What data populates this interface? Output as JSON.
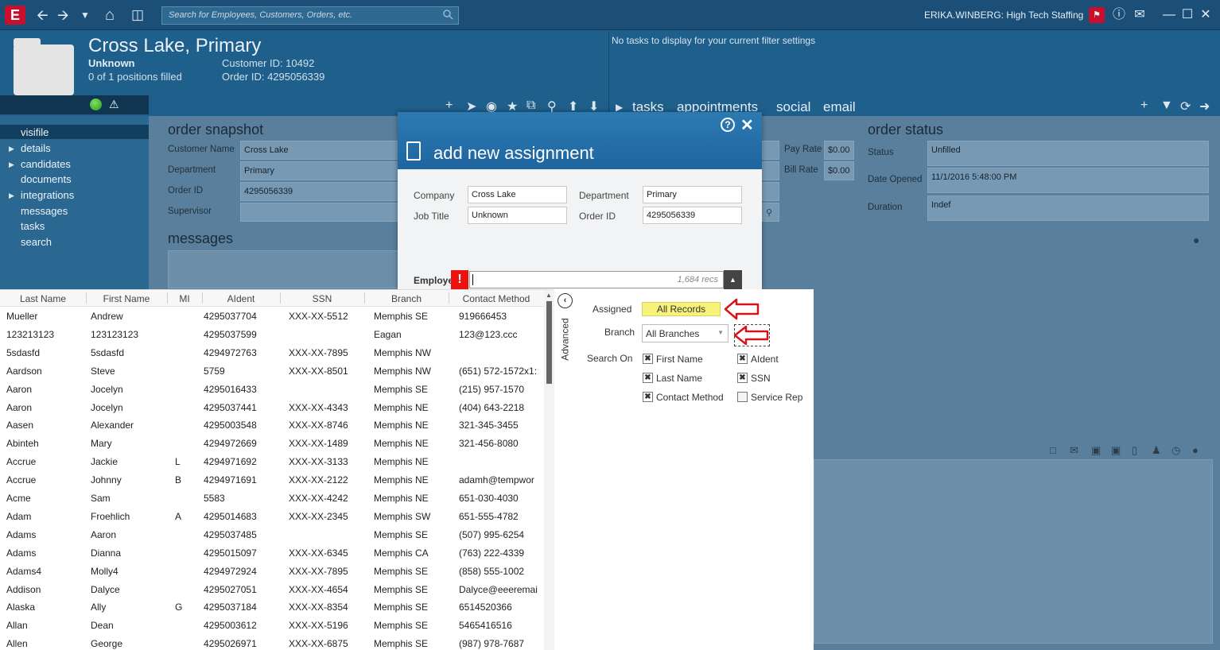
{
  "app": {
    "logo": "E",
    "search_placeholder": "Search for Employees, Customers, Orders, etc.",
    "user": "ERIKA.WINBERG: High Tech Staffing"
  },
  "order": {
    "title": "Cross Lake, Primary",
    "job_title": "Unknown",
    "positions": "0 of 1 positions filled",
    "customer_id": "Customer ID: 10492",
    "order_id": "Order ID: 4295056339"
  },
  "tasks": {
    "empty_message": "No tasks to display for your current filter settings",
    "tabs": [
      "tasks",
      "appointments",
      "social",
      "email"
    ]
  },
  "nav": {
    "items": [
      "visifile",
      "details",
      "candidates",
      "documents",
      "integrations",
      "messages",
      "tasks",
      "search"
    ]
  },
  "snapshot": {
    "title": "order snapshot",
    "customer_name_label": "Customer Name",
    "customer_name": "Cross Lake",
    "department_label": "Department",
    "department": "Primary",
    "order_id_label": "Order ID",
    "order_id": "4295056339",
    "supervisor_label": "Supervisor",
    "pay_rate_label": "Pay Rate",
    "pay_rate": "$0.00",
    "bill_rate_label": "Bill Rate",
    "bill_rate": "$0.00",
    "messages_title": "messages"
  },
  "order_status": {
    "title": "order status",
    "status_label": "Status",
    "status": "Unfilled",
    "date_opened_label": "Date Opened",
    "date_opened": "11/1/2016 5:48:00 PM",
    "duration_label": "Duration",
    "duration": "Indef"
  },
  "modal": {
    "title": "add new assignment",
    "company_label": "Company",
    "company": "Cross Lake",
    "department_label": "Department",
    "department": "Primary",
    "job_title_label": "Job Title",
    "job_title": "Unknown",
    "order_id_label": "Order ID",
    "order_id": "4295056339",
    "employee_label": "Employee",
    "records": "1,684 recs"
  },
  "grid": {
    "columns": [
      "Last Name",
      "First Name",
      "MI",
      "AIdent",
      "SSN",
      "Branch",
      "Contact Method"
    ],
    "rows": [
      [
        "Mueller",
        "Andrew",
        "",
        "4295037704",
        "XXX-XX-5512",
        "Memphis SE",
        "919666453"
      ],
      [
        "123213123",
        "123123123",
        "",
        "4295037599",
        "",
        "Eagan",
        "123@123.ccc"
      ],
      [
        "5sdasfd",
        "5sdasfd",
        "",
        "4294972763",
        "XXX-XX-7895",
        "Memphis NW",
        ""
      ],
      [
        "Aardson",
        "Steve",
        "",
        "5759",
        "XXX-XX-8501",
        "Memphis NW",
        "(651) 572-1572x1:"
      ],
      [
        "Aaron",
        "Jocelyn",
        "",
        "4295016433",
        "",
        "Memphis SE",
        "(215) 957-1570"
      ],
      [
        "Aaron",
        "Jocelyn",
        "",
        "4295037441",
        "XXX-XX-4343",
        "Memphis NE",
        "(404) 643-2218"
      ],
      [
        "Aasen",
        "Alexander",
        "",
        "4295003548",
        "XXX-XX-8746",
        "Memphis NE",
        "321-345-3455"
      ],
      [
        "Abinteh",
        "Mary",
        "",
        "4294972669",
        "XXX-XX-1489",
        "Memphis NE",
        "321-456-8080"
      ],
      [
        "Accrue",
        "Jackie",
        "L",
        "4294971692",
        "XXX-XX-3133",
        "Memphis NE",
        ""
      ],
      [
        "Accrue",
        "Johnny",
        "B",
        "4294971691",
        "XXX-XX-2122",
        "Memphis NE",
        "adamh@tempwor"
      ],
      [
        "Acme",
        "Sam",
        "",
        "5583",
        "XXX-XX-4242",
        "Memphis NE",
        "651-030-4030"
      ],
      [
        "Adam",
        "Froehlich",
        "A",
        "4295014683",
        "XXX-XX-2345",
        "Memphis SW",
        "651-555-4782"
      ],
      [
        "Adams",
        "Aaron",
        "",
        "4295037485",
        "",
        "Memphis SE",
        "(507) 995-6254"
      ],
      [
        "Adams",
        "Dianna",
        "",
        "4295015097",
        "XXX-XX-6345",
        "Memphis CA",
        "(763) 222-4339"
      ],
      [
        "Adams4",
        "Molly4",
        "",
        "4294972924",
        "XXX-XX-7895",
        "Memphis SE",
        "(858) 555-1002"
      ],
      [
        "Addison",
        "Dalyce",
        "",
        "4295027051",
        "XXX-XX-4654",
        "Memphis SE",
        "Dalyce@eeeremai"
      ],
      [
        "Alaska",
        "Ally",
        "G",
        "4295037184",
        "XXX-XX-8354",
        "Memphis SE",
        "6514520366"
      ],
      [
        "Allan",
        "Dean",
        "",
        "4295003612",
        "XXX-XX-5196",
        "Memphis SE",
        "5465416516"
      ],
      [
        "Allen",
        "George",
        "",
        "4295026971",
        "XXX-XX-6875",
        "Memphis SE",
        "(987) 978-7687"
      ]
    ]
  },
  "advanced": {
    "tab_label": "Advanced",
    "assigned_label": "Assigned",
    "assigned_value": "All Records",
    "branch_label": "Branch",
    "branch_value": "All Branches",
    "search_on_label": "Search On",
    "options": [
      {
        "label": "First Name",
        "checked": true
      },
      {
        "label": "AIdent",
        "checked": true
      },
      {
        "label": "Last Name",
        "checked": true
      },
      {
        "label": "SSN",
        "checked": true
      },
      {
        "label": "Contact Method",
        "checked": true
      },
      {
        "label": "Service Rep",
        "checked": false
      }
    ]
  }
}
